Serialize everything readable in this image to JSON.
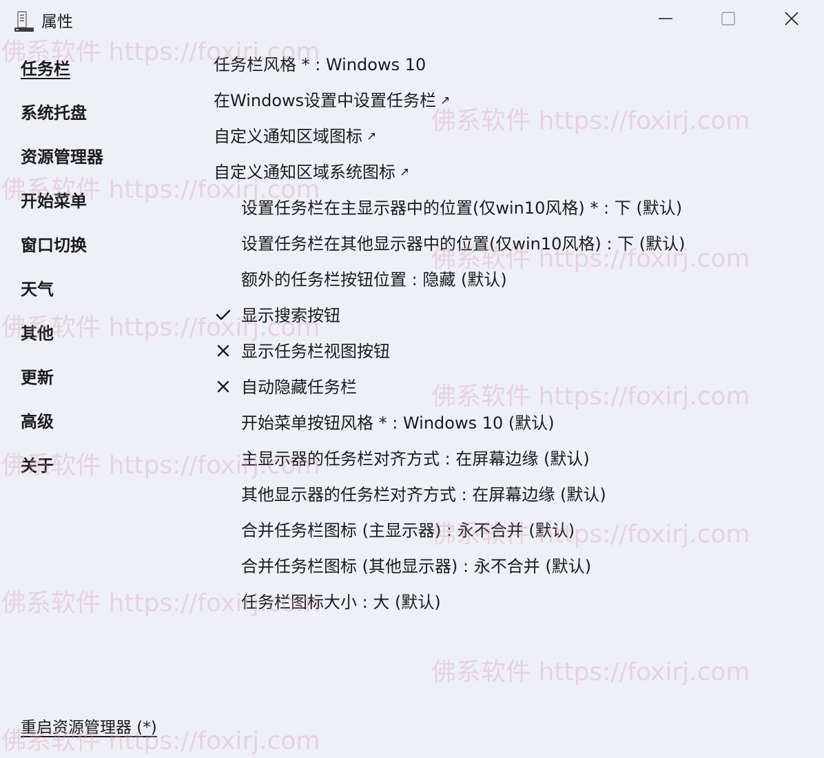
{
  "window": {
    "title": "属性",
    "icons": {
      "app": "settings-app-icon",
      "minimize": "minimize-icon",
      "maximize": "maximize-icon",
      "close": "close-icon"
    }
  },
  "sidebar": {
    "items": [
      {
        "label": "任务栏",
        "active": true
      },
      {
        "label": "系统托盘"
      },
      {
        "label": "资源管理器"
      },
      {
        "label": "开始菜单"
      },
      {
        "label": "窗口切换"
      },
      {
        "label": "天气"
      },
      {
        "label": "其他"
      },
      {
        "label": "更新"
      },
      {
        "label": "高级"
      },
      {
        "label": "关于"
      }
    ],
    "restart_label": "重启资源管理器 (*)"
  },
  "settings": {
    "rows": [
      {
        "label": "任务栏风格 * : Windows 10"
      },
      {
        "label": "在Windows设置中设置任务栏",
        "external": true
      },
      {
        "label": "自定义通知区域图标",
        "external": true
      },
      {
        "label": "自定义通知区域系统图标",
        "external": true
      },
      {
        "label": "设置任务栏在主显示器中的位置(仅win10风格) * : 下 (默认)"
      },
      {
        "label": "设置任务栏在其他显示器中的位置(仅win10风格) : 下 (默认)"
      },
      {
        "label": "额外的任务栏按钮位置 : 隐藏 (默认)"
      },
      {
        "label": "显示搜索按钮",
        "state": "checked"
      },
      {
        "label": "显示任务栏视图按钮",
        "state": "unchecked"
      },
      {
        "label": "自动隐藏任务栏",
        "state": "unchecked"
      },
      {
        "label": "开始菜单按钮风格 * : Windows 10 (默认)"
      },
      {
        "label": "主显示器的任务栏对齐方式 : 在屏幕边缘 (默认)"
      },
      {
        "label": "其他显示器的任务栏对齐方式 : 在屏幕边缘 (默认)"
      },
      {
        "label": "合并任务栏图标 (主显示器) : 永不合并 (默认)"
      },
      {
        "label": "合并任务栏图标 (其他显示器) : 永不合并 (默认)"
      },
      {
        "label": "任务栏图标大小 : 大 (默认)"
      }
    ],
    "external_glyph": "↗",
    "icons": {
      "checked": "checkmark-icon",
      "unchecked": "cross-icon",
      "external": "external-link-icon"
    }
  },
  "watermark": {
    "text": "佛系软件 https://foxirj.com"
  },
  "colors": {
    "background": "#eef0f7",
    "text": "#1b1b1b",
    "watermark": "#e096aa"
  }
}
